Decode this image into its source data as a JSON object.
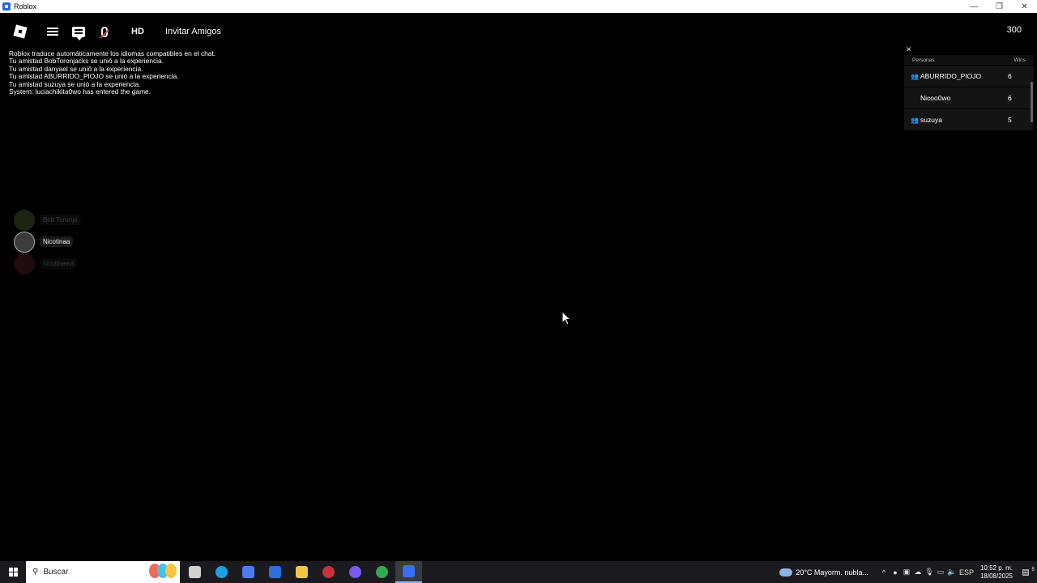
{
  "window": {
    "title": "Roblox",
    "controls": [
      "—",
      "❐",
      "✕"
    ]
  },
  "topbar": {
    "hd_label": "HD",
    "invite_label": "Invitar Amigos",
    "currency": "300"
  },
  "chat": {
    "messages": [
      "Roblox traduce automáticamente los idiomas compatibles en el chat.",
      "Tu amistad BobToronjacks se unió a la experiencia.",
      "Tu amistad danyael se unió a la experiencia.",
      "Tu amistad ABURRIDO_PIOJO se unió a la experiencia.",
      "Tu amistad suzuya se unió a la experiencia.",
      "System: luciachikita0wo has entered the game."
    ]
  },
  "voice": {
    "participants": [
      {
        "name": "Bob Toronja",
        "state": "faded"
      },
      {
        "name": "Nicotinaa",
        "state": "active"
      },
      {
        "name": "nicotineevt",
        "state": "faded"
      }
    ]
  },
  "leaderboard": {
    "header_people": "Personas",
    "header_wins": "Wins",
    "rows": [
      {
        "name": "ABURRIDO_PIOJO",
        "wins": "6",
        "friend": true
      },
      {
        "name": "Nicoo0wo",
        "wins": "6",
        "friend": false
      },
      {
        "name": "suzuya",
        "wins": "5",
        "friend": true
      }
    ]
  },
  "taskbar": {
    "search_placeholder": "Buscar",
    "apps": [
      {
        "name": "task-view",
        "color": "#d0d0d0"
      },
      {
        "name": "edge",
        "color": "#1fa0e0"
      },
      {
        "name": "copilot",
        "color": "#4a7cf0"
      },
      {
        "name": "app-blue",
        "color": "#2d6fd6"
      },
      {
        "name": "file-explorer",
        "color": "#f3c542"
      },
      {
        "name": "app-red",
        "color": "#c8323a"
      },
      {
        "name": "chrome-profile",
        "color": "#7a5af0"
      },
      {
        "name": "chrome",
        "color": "#34a853"
      },
      {
        "name": "roblox",
        "color": "#3b6df5"
      }
    ],
    "weather": "20°C  Mayorm. nubla...",
    "language": "ESP",
    "time": "10:52 p. m.",
    "date": "18/08/2025",
    "notifications": "5"
  }
}
